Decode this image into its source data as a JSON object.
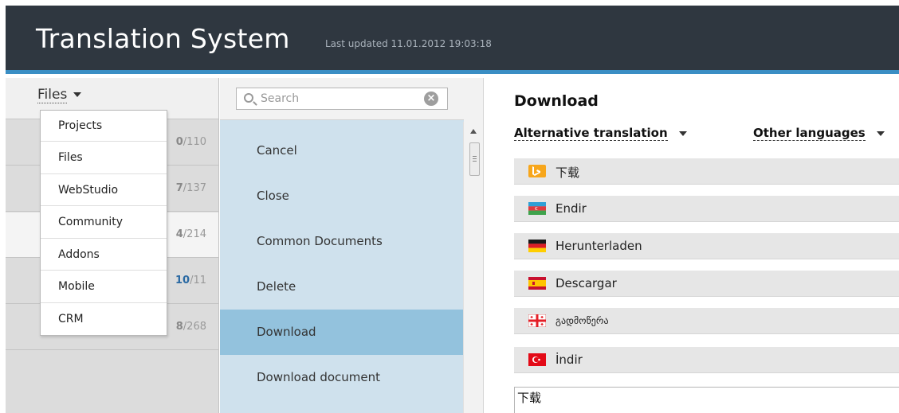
{
  "header": {
    "title": "Translation System",
    "last_updated": "Last updated 11.01.2012 19:03:18",
    "accent_color": "#3a8ec4",
    "background_color": "#2f3740"
  },
  "files_panel": {
    "toggle_label": "Files",
    "dropdown_options": [
      "Projects",
      "Files",
      "WebStudio",
      "Community",
      "Addons",
      "Mobile",
      "CRM"
    ],
    "projects": [
      {
        "done": "0",
        "total": "/110",
        "active": false,
        "highlight": false
      },
      {
        "done": "7",
        "total": "/137",
        "active": false,
        "highlight": false
      },
      {
        "done": "4",
        "total": "/214",
        "active": true,
        "highlight": false
      },
      {
        "done": "10",
        "total": "/11",
        "active": false,
        "highlight": true
      },
      {
        "done": "8",
        "total": "/268",
        "active": false,
        "highlight": false
      }
    ]
  },
  "keys_panel": {
    "search_placeholder": "Search",
    "items": [
      "Cancel",
      "Close",
      "Common Documents",
      "Delete",
      "Download",
      "Download document"
    ],
    "selected": "Download"
  },
  "detail": {
    "title": "Download",
    "alt_translation_label": "Alternative translation",
    "other_languages_label": "Other languages",
    "languages": [
      {
        "flag": "bing-icon",
        "text": "下载"
      },
      {
        "flag": "azerbaijan-flag-icon",
        "text": "Endir"
      },
      {
        "flag": "germany-flag-icon",
        "text": "Herunterladen"
      },
      {
        "flag": "spain-flag-icon",
        "text": "Descargar"
      },
      {
        "flag": "georgia-flag-icon",
        "text": "გადმოწერა"
      },
      {
        "flag": "turkey-flag-icon",
        "text": "İndir"
      }
    ],
    "translation_value": "下载"
  }
}
